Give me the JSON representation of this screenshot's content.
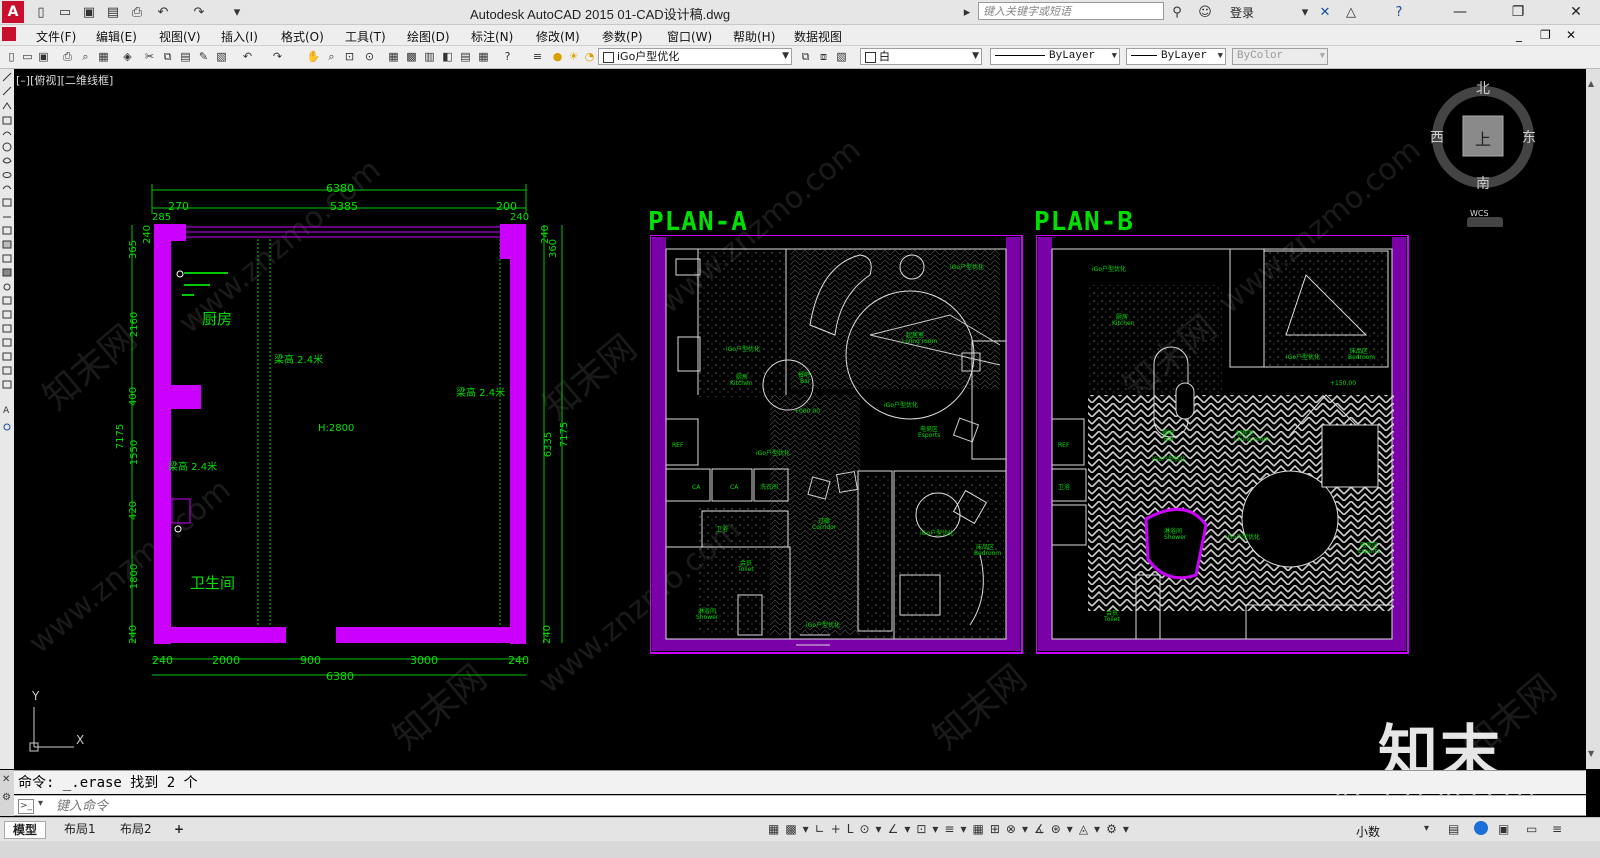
{
  "titlebar": {
    "app_title": "Autodesk AutoCAD 2015    01-CAD设计稿.dwg",
    "search_placeholder": "键入关键字或短语",
    "login_label": "登录"
  },
  "menubar": {
    "items": [
      "文件(F)",
      "编辑(E)",
      "视图(V)",
      "插入(I)",
      "格式(O)",
      "工具(T)",
      "绘图(D)",
      "标注(N)",
      "修改(M)",
      "参数(P)",
      "窗口(W)",
      "帮助(H)",
      "数据视图"
    ]
  },
  "toolbar": {
    "layer_value": "iGo户型优化",
    "color_value": "白",
    "linetype_value": "ByLayer",
    "lineweight_value": "ByLayer",
    "plotstyle_value": "ByColor"
  },
  "viewport": {
    "label": "[–][俯视][二维线框]"
  },
  "viewcube": {
    "north": "北",
    "south": "南",
    "east": "东",
    "west": "西",
    "top": "上",
    "wcs": "WCS"
  },
  "ucs": {
    "x": "X",
    "y": "Y"
  },
  "left_plan": {
    "dim_top_total": "6380",
    "dim_top_left": "270",
    "dim_top_mid": "5385",
    "dim_top_right": "200",
    "dim_top_285": "285",
    "dim_top_240": "240",
    "dim_left_365": "365",
    "dim_left_240": "240",
    "dim_left_2160": "2160",
    "dim_left_400": "400",
    "dim_left_7175": "7175",
    "dim_left_1550": "1550",
    "dim_left_420": "420",
    "dim_left_1800": "1800",
    "dim_left_240b": "240",
    "dim_right_240": "240",
    "dim_right_360": "360",
    "dim_right_6335": "6335",
    "dim_right_7175": "7175",
    "dim_right_240b": "240",
    "dim_bottom_240": "240",
    "dim_bottom_2000": "2000",
    "dim_bottom_900": "900",
    "dim_bottom_3000": "3000",
    "dim_bottom_240b": "240",
    "dim_bottom_total": "6380",
    "room_kitchen": "厨房",
    "room_bath": "卫生间",
    "beam1": "梁高 2.4米",
    "beam2": "梁高 2.4米",
    "beam3": "梁高 2.4米",
    "height": "H:2800"
  },
  "plan_a": {
    "title": "PLAN-A"
  },
  "plan_b": {
    "title": "PLAN-B"
  },
  "watermark": {
    "brand": "知末",
    "id": "ID: 1213037215",
    "site": "www.znzmo.com",
    "site_cn": "知末网"
  },
  "command": {
    "history": "命令: _.erase 找到 2 个",
    "input_placeholder": "键入命令"
  },
  "statusbar": {
    "tabs": [
      "模型",
      "布局1",
      "布局2"
    ],
    "units": "小数"
  }
}
